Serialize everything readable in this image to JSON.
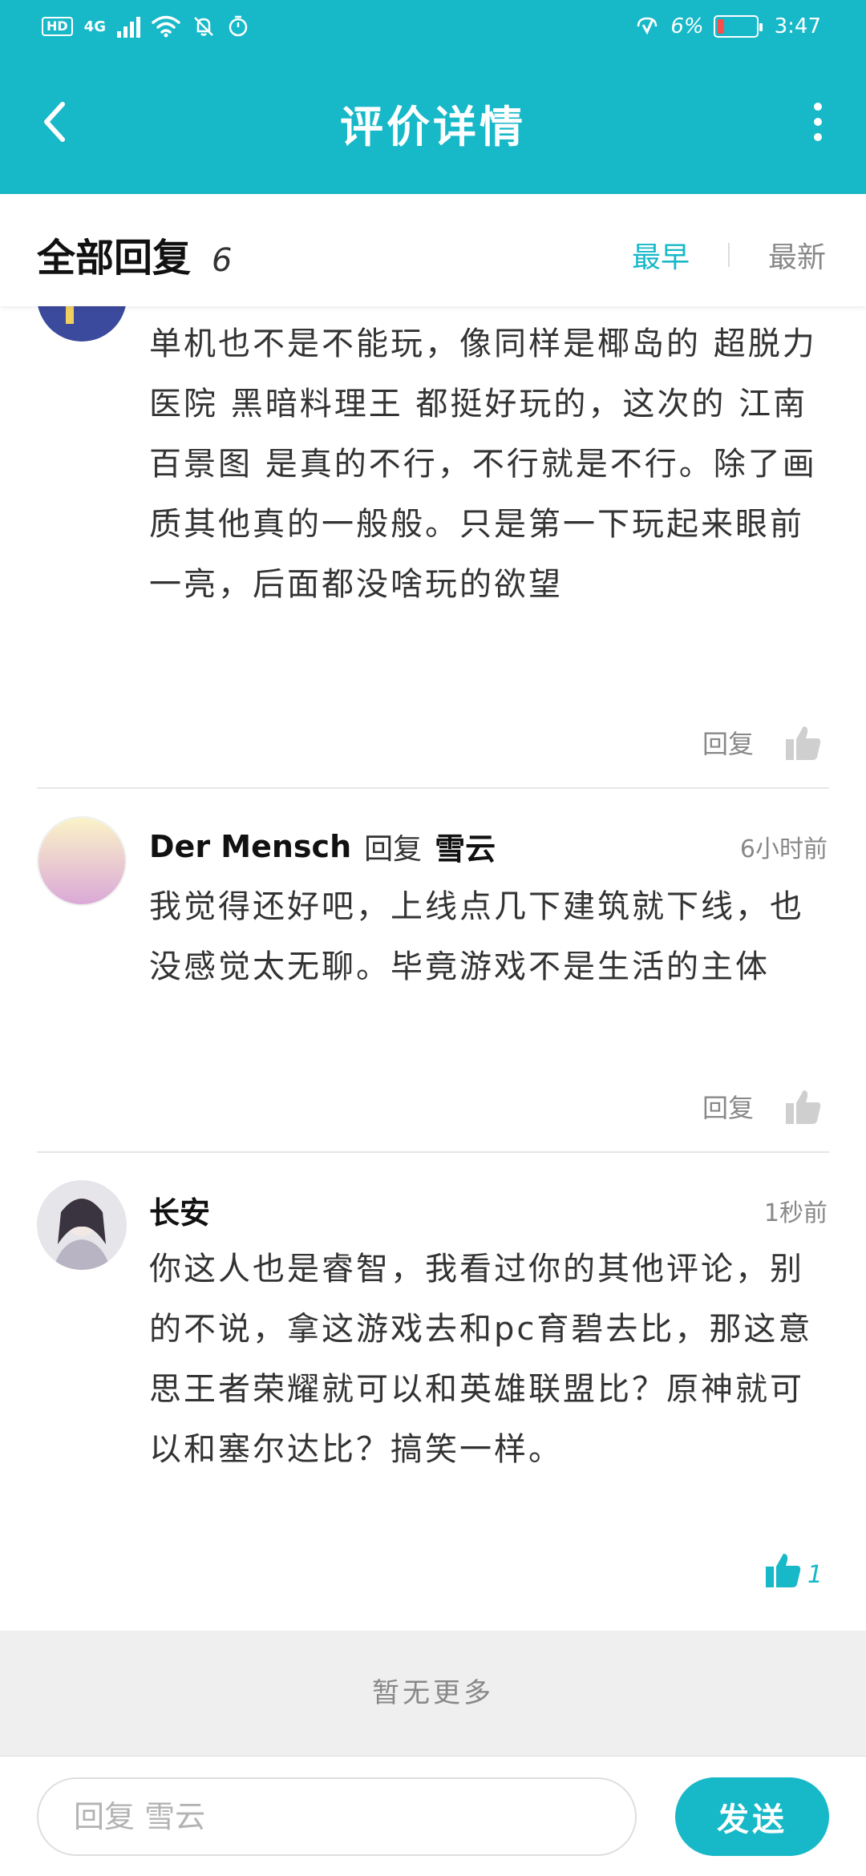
{
  "status_bar": {
    "network": "4G",
    "hd": "HD",
    "battery": "6%",
    "time": "3:47",
    "icons": [
      "hd-icon",
      "signal-icon",
      "wifi-icon",
      "mute-icon",
      "alarm-icon",
      "charging-icon",
      "battery-icon"
    ]
  },
  "app_bar": {
    "title": "评价详情",
    "back_icon": "chevron-left-icon",
    "more_icon": "more-vertical-icon"
  },
  "replies_header": {
    "label": "全部回复",
    "count": "6",
    "sort_earliest": "最早",
    "sort_latest": "最新",
    "active_sort": "最早"
  },
  "comments": [
    {
      "body": "单机也不是不能玩，像同样是椰岛的  超脱力医院  黑暗料理王  都挺好玩的，这次的  江南百景图   是真的不行，不行就是不行。除了画质其他真的一般般。只是第一下玩起来眼前一亮，后面都没啥玩的欲望",
      "reply_label": "回复",
      "likes": ""
    },
    {
      "author": "Der Mensch",
      "reply_word": "回复",
      "target": "雪云",
      "time": "6小时前",
      "body": "我觉得还好吧，上线点几下建筑就下线，也没感觉太无聊。毕竟游戏不是生活的主体",
      "reply_label": "回复",
      "likes": ""
    },
    {
      "author": "长安",
      "time": "1秒前",
      "body": "你这人也是睿智，我看过你的其他评论，别的不说，拿这游戏去和pc育碧去比，那这意思王者荣耀就可以和英雄联盟比？原神就可以和塞尔达比？搞笑一样。",
      "likes": "1",
      "liked": true
    }
  ],
  "footer": {
    "no_more": "暂无更多"
  },
  "composer": {
    "placeholder": "回复 雪云",
    "send_label": "发送"
  },
  "colors": {
    "accent": "#17b8c8",
    "muted": "#888888",
    "like_inactive": "#cfcfcf"
  }
}
